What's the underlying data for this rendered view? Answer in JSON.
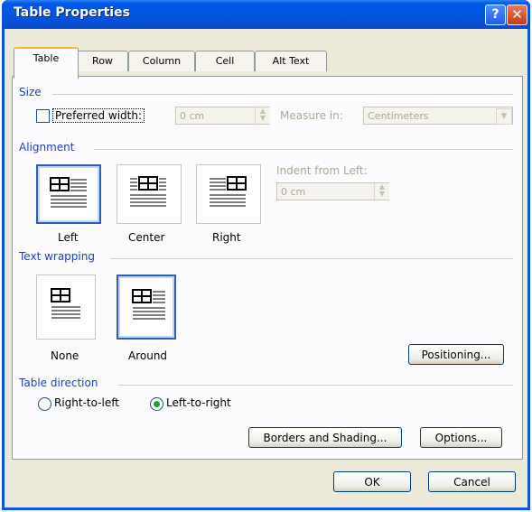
{
  "window": {
    "title": "Table Properties",
    "help_label": "?",
    "close_label": "✕"
  },
  "tabs": [
    {
      "label": "Table",
      "active": true
    },
    {
      "label": "Row",
      "active": false
    },
    {
      "label": "Column",
      "active": false
    },
    {
      "label": "Cell",
      "active": false
    },
    {
      "label": "Alt Text",
      "active": false
    }
  ],
  "size": {
    "group_label": "Size",
    "preferred_width_label": "Preferred width:",
    "preferred_width_checked": false,
    "preferred_width_value": "0 cm",
    "measure_in_label": "Measure in:",
    "measure_in_value": "Centimeters"
  },
  "alignment": {
    "group_label": "Alignment",
    "options": [
      {
        "label": "Left",
        "selected": true
      },
      {
        "label": "Center",
        "selected": false
      },
      {
        "label": "Right",
        "selected": false
      }
    ],
    "indent_label": "Indent from Left:",
    "indent_value": "0 cm"
  },
  "text_wrapping": {
    "group_label": "Text wrapping",
    "options": [
      {
        "label": "None",
        "selected": false
      },
      {
        "label": "Around",
        "selected": true
      }
    ],
    "positioning_label": "Positioning..."
  },
  "table_direction": {
    "group_label": "Table direction",
    "options": [
      {
        "label": "Right-to-left",
        "selected": false
      },
      {
        "label": "Left-to-right",
        "selected": true
      }
    ]
  },
  "buttons": {
    "borders_shading": "Borders and Shading...",
    "options": "Options...",
    "ok": "OK",
    "cancel": "Cancel"
  },
  "colors": {
    "title_bar": "#0055dd",
    "group_label": "#1c3fd0",
    "selected_border": "#2f5fb1",
    "radio_dot": "#21a121"
  }
}
